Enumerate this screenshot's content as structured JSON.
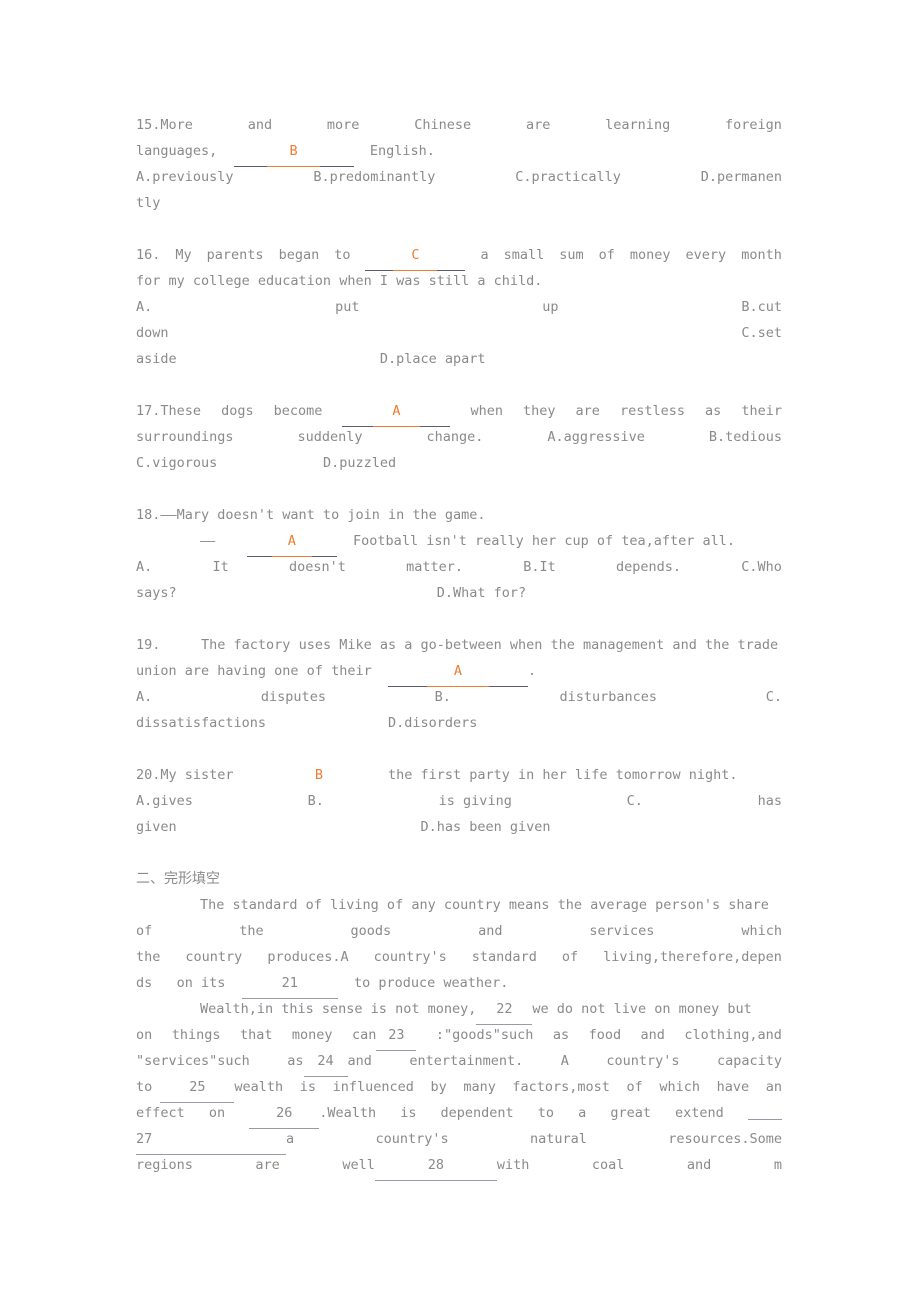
{
  "document": {
    "type": "english-exam-worksheet",
    "text_color": "#8a8a8a",
    "answer_color": "#ED7D31",
    "rule_color": "#5b5b72",
    "cloze_rule_color": "#9a9aa6"
  },
  "questions": [
    {
      "number": "15.",
      "stem_words_line1": [
        "15.More",
        "and",
        "more",
        "Chinese",
        "are",
        "learning",
        "foreign"
      ],
      "stem_line2_pre": "languages,",
      "answer": "B",
      "stem_line2_post": "English.",
      "options_line": [
        "A.previously",
        "B.predominantly",
        "C.practically",
        "D.permanen"
      ],
      "options_overflow": "tly"
    },
    {
      "number": "16.",
      "stem_line1_pre": [
        "16.",
        "My",
        "parents",
        "began",
        "to"
      ],
      "answer": "C",
      "stem_line1_post": [
        "a",
        "small",
        "sum",
        "of",
        "money",
        "every",
        "month"
      ],
      "stem_line2": "for my college education when I was still a child.",
      "options_line1": [
        "A.",
        "put",
        "up",
        "B.cut"
      ],
      "options_line2": [
        "down",
        "C.set"
      ],
      "options_line3": [
        "aside",
        "D.place apart"
      ]
    },
    {
      "number": "17.",
      "stem_line1_pre": [
        "17.These",
        "dogs",
        "become"
      ],
      "answer": "A",
      "stem_line1_post": [
        "when",
        "they",
        "are",
        "restless",
        "as",
        "their"
      ],
      "options_line1": [
        "surroundings",
        "suddenly",
        "change.",
        "A.aggressive",
        "B.tedious"
      ],
      "options_line2": [
        "C.vigorous",
        "D.puzzled"
      ]
    },
    {
      "number": "18.",
      "stem_line1": "18.——Mary doesn't want to join in the game.",
      "dash": "——",
      "answer": "A",
      "stem_line2_post": "Football isn't really her cup of tea,after all.",
      "options_line1": [
        "A.",
        "It",
        "doesn't",
        "matter.",
        "B.It",
        "depends.",
        "C.Who"
      ],
      "options_line2": [
        "says?",
        "D.What for?"
      ]
    },
    {
      "number": "19.",
      "stem_line1": [
        "19.",
        "The factory uses Mike as a go-between when the management and the trade"
      ],
      "stem_line2_pre": "union are having one of their",
      "answer": "A",
      "stem_line2_post": ".",
      "options_line1": [
        "A.",
        "disputes",
        "B.",
        "disturbances",
        "C."
      ],
      "options_line2": [
        "dissatisfactions",
        "D.disorders"
      ]
    },
    {
      "number": "20.",
      "stem_line1_pre": [
        "20.My sister"
      ],
      "answer": "B",
      "stem_line1_post": [
        "the first party in her life tomorrow night."
      ],
      "options_line1": [
        "A.gives",
        "B.",
        "is giving",
        "C.",
        "has"
      ],
      "options_line2": [
        "given",
        "D.has been given"
      ]
    }
  ],
  "section_two": {
    "heading": "二、完形填空",
    "para1": {
      "line1_indent_text": "The standard of living of any country means the average person's share",
      "line2_words": [
        "of",
        "the",
        "goods",
        "and",
        "services",
        "which"
      ],
      "line3_words": [
        "the",
        "country",
        "produces.A",
        "country's",
        "standard",
        "of",
        "living,therefore,depen"
      ],
      "line4_pre": [
        "ds",
        "on its"
      ],
      "line4_blank": "21",
      "line4_post": "to produce weather."
    },
    "para2": {
      "line1_pre": "Wealth,in this sense is not money,",
      "line1_blank": "22",
      "line1_post": "we do not live on money but",
      "line2_words": [
        "on",
        "things",
        "that",
        "money",
        "can"
      ],
      "line2_blank": "23",
      "line2_post_words": [
        ":\"goods\"such",
        "as",
        "food",
        "and",
        "clothing,and"
      ],
      "line3_words": [
        "\"services\"such",
        "as"
      ],
      "line3_blank": "24",
      "line3_post_words": [
        "and",
        "entertainment.",
        "A",
        "country's",
        "capacity"
      ],
      "line4_pre": "to",
      "line4_blank": "25",
      "line4_post_words": [
        "wealth",
        "is",
        "influenced",
        "by",
        "many",
        "factors,most",
        "of",
        "which",
        "have",
        "an"
      ],
      "line5_pre_words": [
        "effect",
        "on"
      ],
      "line5_blank": "26",
      "line5_post_words": [
        ".Wealth",
        "is",
        "dependent",
        "to",
        "a",
        "great",
        "extend"
      ],
      "line6_blank": "27",
      "line6_post_words": [
        "a",
        "country's",
        "natural",
        "resources.Some"
      ],
      "line7_words": [
        "regions",
        "are",
        "well"
      ],
      "line7_blank": "28",
      "line7_post_words": [
        "with",
        "coal",
        "and",
        "m"
      ]
    }
  }
}
